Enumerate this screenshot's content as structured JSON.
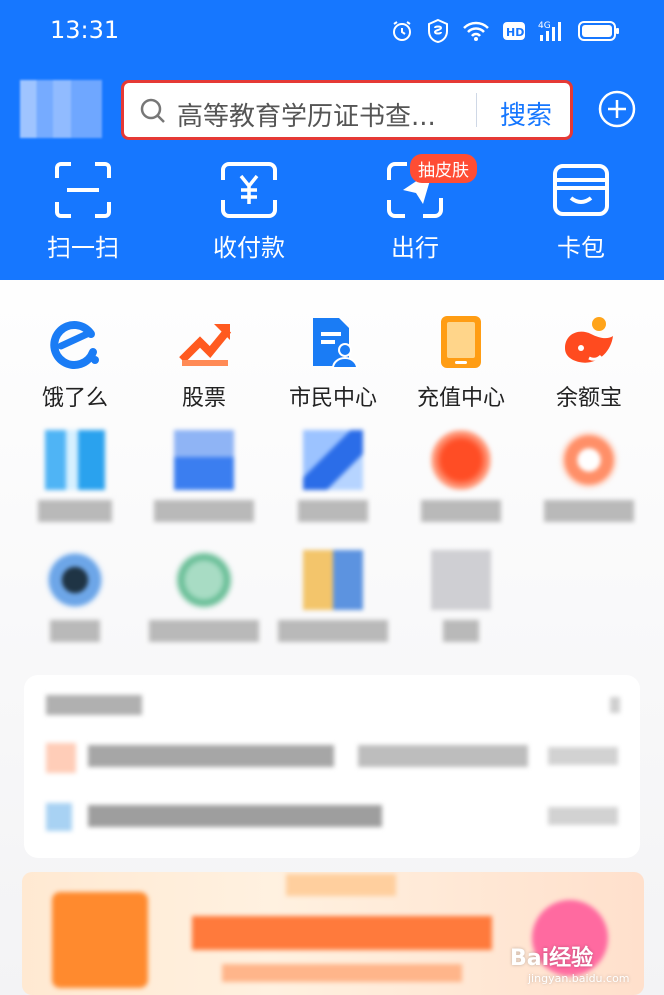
{
  "status_bar": {
    "time": "13:31",
    "network": "4G"
  },
  "search": {
    "placeholder": "高等教育学历证书查...",
    "button_label": "搜索"
  },
  "quick_actions": [
    {
      "label": "扫一扫",
      "icon": "scan-icon"
    },
    {
      "label": "收付款",
      "icon": "pay-receive-icon"
    },
    {
      "label": "出行",
      "icon": "travel-icon",
      "badge": "抽皮肤"
    },
    {
      "label": "卡包",
      "icon": "card-wallet-icon"
    }
  ],
  "apps": [
    {
      "label": "饿了么",
      "icon": "eleme-icon",
      "color": "#1a7cf5"
    },
    {
      "label": "股票",
      "icon": "stocks-icon",
      "color": "#ff5a1f"
    },
    {
      "label": "市民中心",
      "icon": "citizen-center-icon",
      "color": "#1a7cf5"
    },
    {
      "label": "充值中心",
      "icon": "recharge-icon",
      "color": "#ff9d14"
    },
    {
      "label": "余额宝",
      "icon": "yuebao-icon",
      "color": "#ff4b1f"
    }
  ],
  "colors": {
    "brand_blue": "#1677ff",
    "highlight_red": "#e53935",
    "badge_red": "#ff4d34"
  },
  "watermark": {
    "brand": "Bai经验",
    "url": "jingyan.baidu.com"
  }
}
